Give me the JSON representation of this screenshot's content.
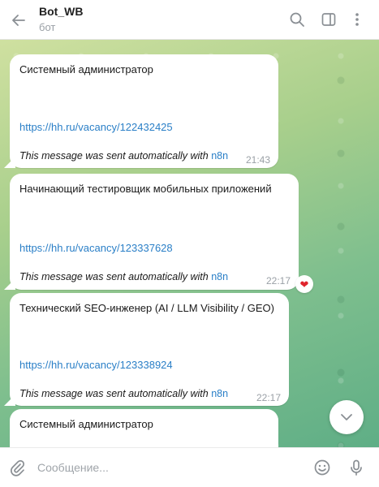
{
  "header": {
    "title": "Bot_WB",
    "subtitle": "бот"
  },
  "messages": [
    {
      "title": "Системный администратор",
      "link": "https://hh.ru/vacancy/122432425",
      "footer_text": "This message was sent automatically with ",
      "footer_link": "n8n",
      "time": "21:43"
    },
    {
      "title": "Начинающий тестировщик мобильных приложений",
      "link": "https://hh.ru/vacancy/123337628",
      "footer_text": "This message was sent automatically with ",
      "footer_link": "n8n",
      "time": "22:17",
      "reaction": "❤"
    },
    {
      "title": "Технический SEO-инженер (AI / LLM Visibility / GEO)",
      "link": "https://hh.ru/vacancy/123338924",
      "footer_text": "This message was sent automatically with ",
      "footer_link": "n8n",
      "time": "22:17"
    },
    {
      "title": "Системный администратор"
    }
  ],
  "composer": {
    "placeholder": "Сообщение..."
  },
  "icons": {
    "back": "arrow-left-icon",
    "search": "search-icon",
    "sidebar": "sidebar-toggle-icon",
    "more": "more-vertical-icon",
    "attach": "paperclip-icon",
    "emoji": "smiley-icon",
    "mic": "microphone-icon",
    "scroll": "chevron-down-icon"
  },
  "colors": {
    "link": "#2a7fc7",
    "reaction": "#e0242c",
    "time": "#9aa0a6"
  }
}
